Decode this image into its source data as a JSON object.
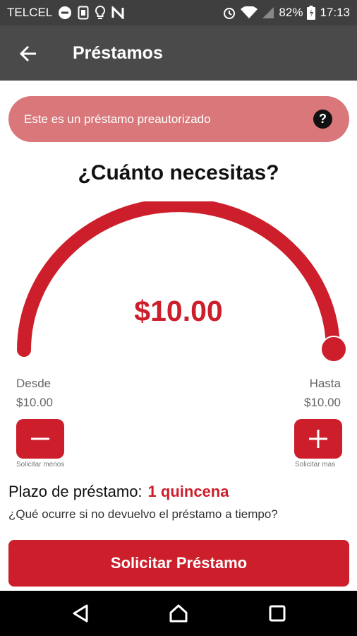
{
  "status_bar": {
    "carrier": "TELCEL",
    "battery": "82%",
    "time": "17:13",
    "icons": [
      "do-not-disturb-icon",
      "sim-icon",
      "lightbulb-icon",
      "nfc-icon",
      "alarm-icon",
      "wifi-icon",
      "signal-icon",
      "battery-icon"
    ]
  },
  "app_bar": {
    "title": "Préstamos",
    "back_icon": "arrow-left-icon"
  },
  "banner": {
    "text": "Este es un préstamo preautorizado",
    "help": "?"
  },
  "loan": {
    "question": "¿Cuánto necesitas?",
    "amount": "$10.00",
    "gauge_fill_fraction": 1.0,
    "from_label": "Desde",
    "from_value": "$10.00",
    "to_label": "Hasta",
    "to_value": "$10.00",
    "decrease_caption": "Solicitar menos",
    "increase_caption": "Solicitar mas"
  },
  "term": {
    "label": "Plazo de préstamo:",
    "value": "1 quincena"
  },
  "late_question": "¿Qué ocurre si no devuelvo el préstamo a tiempo?",
  "cta_label": "Solicitar Préstamo",
  "colors": {
    "accent": "#cc1f2b",
    "banner": "#d9777a",
    "status_bar": "#3f3f3f",
    "app_bar": "#4a4a4a",
    "nav_bar": "#000000"
  }
}
